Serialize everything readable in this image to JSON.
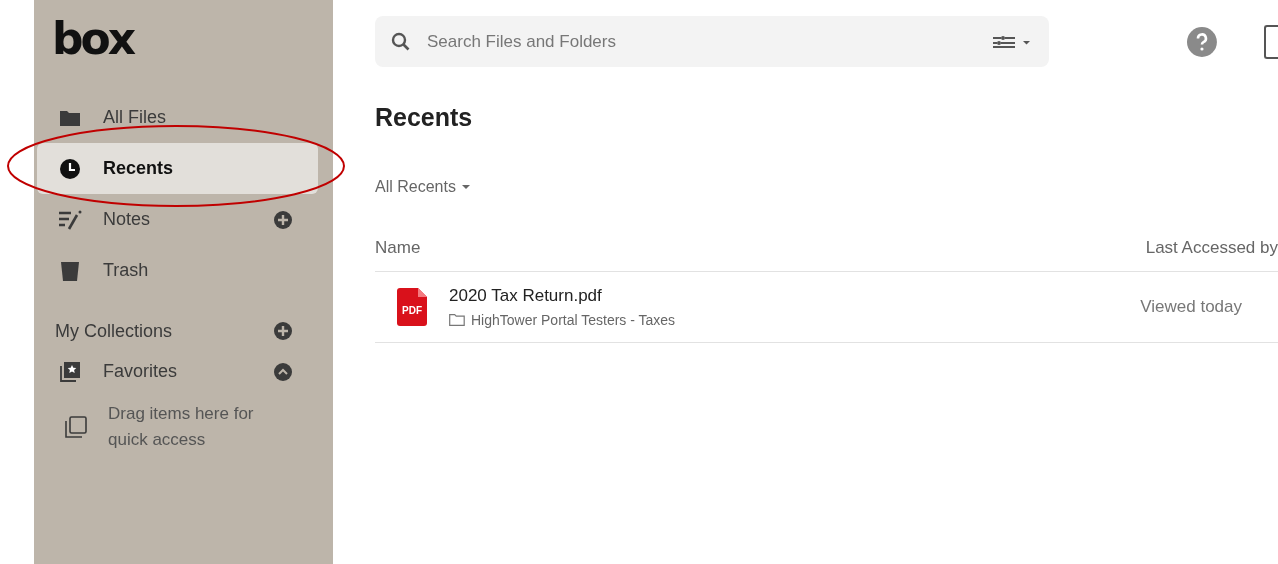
{
  "sidebar": {
    "logo": "box",
    "nav": [
      {
        "label": "All Files",
        "kind": "folder",
        "selected": false,
        "add": false
      },
      {
        "label": "Recents",
        "kind": "clock",
        "selected": true,
        "add": false
      },
      {
        "label": "Notes",
        "kind": "notes",
        "selected": false,
        "add": true
      },
      {
        "label": "Trash",
        "kind": "trash",
        "selected": false,
        "add": false
      }
    ],
    "collections": {
      "title": "My Collections",
      "favorites": {
        "label": "Favorites",
        "expanded": true,
        "empty_text": "Drag items here for quick access"
      }
    }
  },
  "search": {
    "placeholder": "Search Files and Folders"
  },
  "page": {
    "title": "Recents",
    "filter": "All Recents"
  },
  "table": {
    "columns": [
      "Name",
      "Last Accessed by"
    ],
    "rows": [
      {
        "name": "2020 Tax Return.pdf",
        "file_badge": "PDF",
        "folder": "HighTower Portal Testers - Taxes",
        "accessed": "Viewed today"
      }
    ]
  },
  "annotations": [
    {
      "kind": "ellipse",
      "color": "#c00000"
    }
  ]
}
